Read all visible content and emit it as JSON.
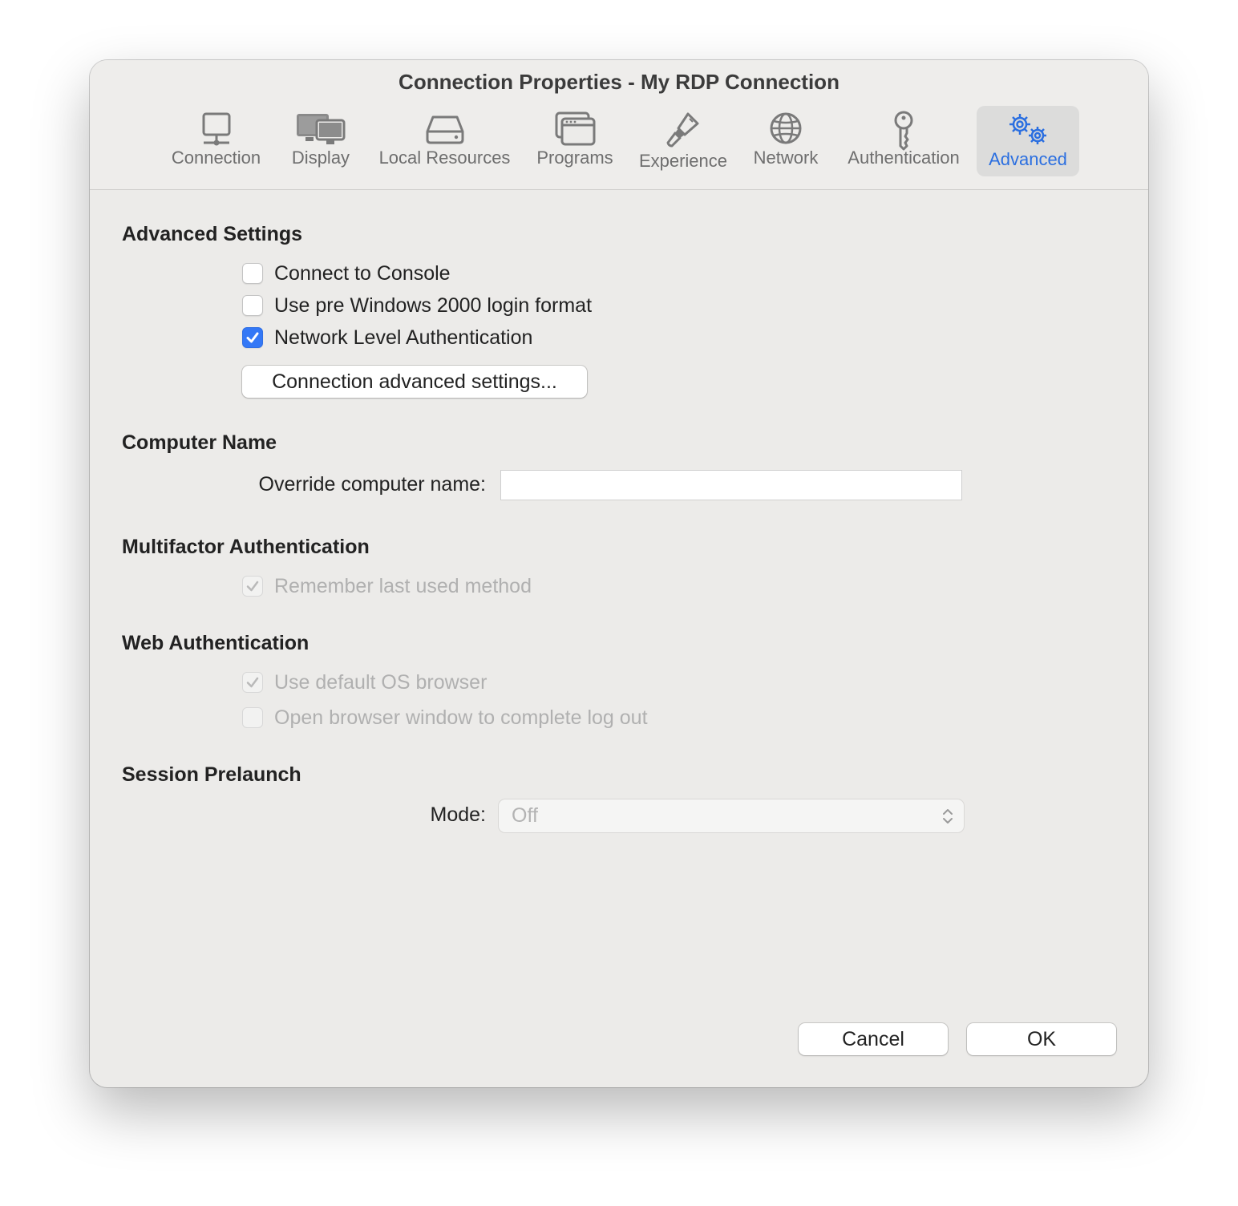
{
  "window": {
    "title": "Connection Properties - My RDP Connection"
  },
  "tabs": [
    {
      "label": "Connection",
      "icon": "monitor-icon"
    },
    {
      "label": "Display",
      "icon": "displays-icon"
    },
    {
      "label": "Local Resources",
      "icon": "drive-icon"
    },
    {
      "label": "Programs",
      "icon": "windows-icon"
    },
    {
      "label": "Experience",
      "icon": "paintbrush-icon"
    },
    {
      "label": "Network",
      "icon": "globe-icon"
    },
    {
      "label": "Authentication",
      "icon": "key-icon"
    },
    {
      "label": "Advanced",
      "icon": "gears-icon",
      "active": true
    }
  ],
  "colors": {
    "accent": "#3478f6",
    "active_tab_text": "#2b6fe0",
    "window_bg": "#ecebe9"
  },
  "advanced_settings": {
    "heading": "Advanced Settings",
    "connect_console": {
      "label": "Connect to Console",
      "checked": false
    },
    "pre_win2000": {
      "label": "Use pre Windows 2000 login format",
      "checked": false
    },
    "nla": {
      "label": "Network Level Authentication",
      "checked": true
    },
    "advanced_button": "Connection advanced settings..."
  },
  "computer_name": {
    "heading": "Computer Name",
    "override_label": "Override computer name:",
    "override_value": ""
  },
  "mfa": {
    "heading": "Multifactor Authentication",
    "remember_method": {
      "label": "Remember last used method",
      "checked": true,
      "disabled": true
    }
  },
  "web_auth": {
    "heading": "Web Authentication",
    "default_browser": {
      "label": "Use default OS browser",
      "checked": true,
      "disabled": true
    },
    "logout_window": {
      "label": "Open browser window to complete log out",
      "checked": false,
      "disabled": true
    }
  },
  "session_prelaunch": {
    "heading": "Session Prelaunch",
    "mode_label": "Mode:",
    "mode_value": "Off"
  },
  "footer": {
    "cancel": "Cancel",
    "ok": "OK"
  }
}
